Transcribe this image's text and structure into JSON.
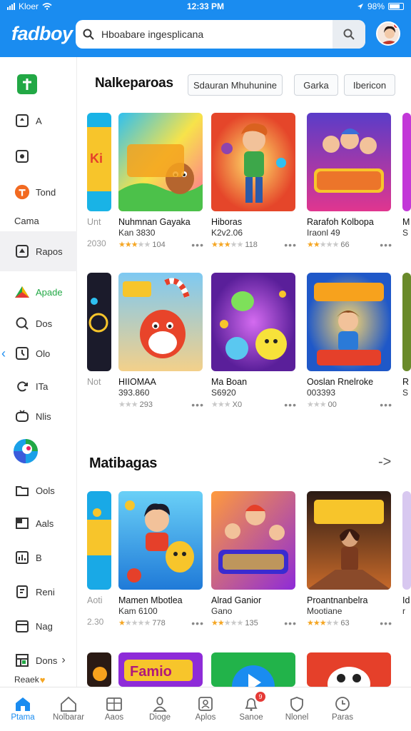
{
  "status_bar": {
    "carrier": "Kloer",
    "time": "12:33 PM",
    "battery": "98%"
  },
  "header": {
    "logo": "fadboy",
    "search_value": "Hboabare ingesplicana"
  },
  "sidebar": {
    "items": [
      {
        "label": "",
        "icon": "app-plus-icon"
      },
      {
        "label": "A",
        "icon": "puzzle-icon"
      },
      {
        "label": "",
        "icon": "camera-icon"
      },
      {
        "label": "Tond",
        "icon": "orange-badge-icon"
      },
      {
        "label": "Cama",
        "icon": ""
      },
      {
        "label": "Rapos",
        "icon": "pin-icon"
      },
      {
        "label": "Apade",
        "icon": "triangle-logo-icon"
      },
      {
        "label": "Dos",
        "icon": "search-circle-icon"
      },
      {
        "label": "Olo",
        "icon": "timer-icon"
      },
      {
        "label": "ITa",
        "icon": "refresh-icon"
      },
      {
        "label": "Nlis",
        "icon": "tv-icon"
      },
      {
        "label": "",
        "icon": "globe-logo-icon"
      },
      {
        "label": "Ools",
        "icon": "folder-icon"
      },
      {
        "label": "Aals",
        "icon": "flag-icon"
      },
      {
        "label": "B",
        "icon": "chart-icon"
      },
      {
        "label": "Reni",
        "icon": "note-icon"
      },
      {
        "label": "Nag",
        "icon": "calendar-icon"
      },
      {
        "label": "Dons",
        "icon": "grid-icon"
      },
      {
        "label": "Reaek",
        "icon": "heart-icon"
      }
    ]
  },
  "section1": {
    "title": "Nalkeparoas",
    "chips": [
      "Sdauran Mhuhunine",
      "Garka",
      "Ibericon"
    ],
    "left_partial_labels": [
      {
        "title": "Unt",
        "sub": "",
        "num": "2030"
      },
      {
        "title": "Not",
        "sub": "",
        "num": ""
      }
    ],
    "right_partial_labels": [
      {
        "title": "M",
        "sub": "S"
      },
      {
        "title": "R",
        "sub": "S"
      }
    ],
    "rows": [
      [
        {
          "title": "Nuhmnan Gayaka",
          "sub": "Kan 3830",
          "rating": "104",
          "stars": 3
        },
        {
          "title": "Hiboras",
          "sub": "K2v2.06",
          "rating": "118",
          "stars": 3
        },
        {
          "title": "Rarafoh Kolbopa",
          "sub": "Iraonl 49",
          "rating": "66",
          "stars": 2
        }
      ],
      [
        {
          "title": "HIIOMAA",
          "sub": "393.860",
          "rating": "293",
          "stars": 0
        },
        {
          "title": "Ma Boan",
          "sub": "S6920",
          "rating": "X0",
          "stars": 0
        },
        {
          "title": "Ooslan Rnelroke",
          "sub": "003393",
          "rating": "00",
          "stars": 0
        }
      ]
    ]
  },
  "section2": {
    "title": "Matibagas",
    "arrow": "->",
    "left_partial_label": {
      "title": "Aoti",
      "sub": "",
      "num": "2.30"
    },
    "right_partial_label": {
      "title": "Id",
      "sub": "r"
    },
    "row": [
      {
        "title": "Mamen Mbotlea",
        "sub": "Kam 6100",
        "rating": "778",
        "stars": 1
      },
      {
        "title": "Alrad Ganior",
        "sub": "Gano",
        "rating": "135",
        "stars": 2
      },
      {
        "title": "Proantnanbelra",
        "sub": "Mootiane",
        "rating": "63",
        "stars": 3
      }
    ]
  },
  "bottom_nav": {
    "items": [
      {
        "label": "Ptama",
        "icon": "home-icon"
      },
      {
        "label": "Nolbarar",
        "icon": "house-outline-icon"
      },
      {
        "label": "Aaos",
        "icon": "cards-icon"
      },
      {
        "label": "Dioge",
        "icon": "user-icon"
      },
      {
        "label": "Aplos",
        "icon": "apps-icon"
      },
      {
        "label": "Sanoe",
        "icon": "bell-icon",
        "badge": "9"
      },
      {
        "label": "Nlonel",
        "icon": "shield-icon"
      },
      {
        "label": "Paras",
        "icon": "clock-icon"
      }
    ]
  },
  "colors": {
    "accent": "#1a8cf0",
    "active_green": "#22a845"
  }
}
